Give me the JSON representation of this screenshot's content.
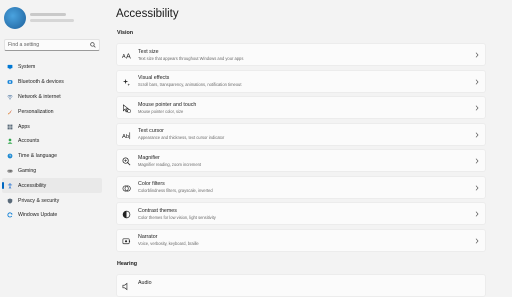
{
  "sidebar": {
    "search_placeholder": "Find a setting",
    "items": [
      {
        "label": "System",
        "icon": "system-icon",
        "color": "#0078d4"
      },
      {
        "label": "Bluetooth & devices",
        "icon": "bluetooth-icon",
        "color": "#0078d4"
      },
      {
        "label": "Network & internet",
        "icon": "network-icon",
        "color": "#5a7fa8"
      },
      {
        "label": "Personalization",
        "icon": "brush-icon",
        "color": "#d15c2b"
      },
      {
        "label": "Apps",
        "icon": "apps-icon",
        "color": "#5b6b7a"
      },
      {
        "label": "Accounts",
        "icon": "accounts-icon",
        "color": "#2ea64a"
      },
      {
        "label": "Time & language",
        "icon": "time-language-icon",
        "color": "#1f8ad2"
      },
      {
        "label": "Gaming",
        "icon": "gaming-icon",
        "color": "#6b6b6b"
      },
      {
        "label": "Accessibility",
        "icon": "accessibility-icon",
        "color": "#1f6fd1",
        "active": true
      },
      {
        "label": "Privacy & security",
        "icon": "shield-icon",
        "color": "#5b6b7a"
      },
      {
        "label": "Windows Update",
        "icon": "windows-update-icon",
        "color": "#0078d4"
      }
    ]
  },
  "main": {
    "title": "Accessibility",
    "sections": [
      {
        "title": "Vision"
      },
      {
        "title": "Hearing"
      }
    ],
    "vision_cards": [
      {
        "title": "Text size",
        "subtitle": "Text size that appears throughout Windows and your apps",
        "icon": "text-size-icon"
      },
      {
        "title": "Visual effects",
        "subtitle": "Scroll bars, transparency, animations, notification timeout",
        "icon": "visual-effects-icon"
      },
      {
        "title": "Mouse pointer and touch",
        "subtitle": "Mouse pointer color, size",
        "icon": "mouse-pointer-icon"
      },
      {
        "title": "Text cursor",
        "subtitle": "Appearance and thickness, text cursor indicator",
        "icon": "text-cursor-icon"
      },
      {
        "title": "Magnifier",
        "subtitle": "Magnifier reading, zoom increment",
        "icon": "magnifier-icon"
      },
      {
        "title": "Color filters",
        "subtitle": "Colorblindness filters, grayscale, inverted",
        "icon": "color-filters-icon"
      },
      {
        "title": "Contrast themes",
        "subtitle": "Color themes for low vision, light sensitivity",
        "icon": "contrast-themes-icon"
      },
      {
        "title": "Narrator",
        "subtitle": "Voice, verbosity, keyboard, braille",
        "icon": "narrator-icon"
      }
    ],
    "hearing_cards": [
      {
        "title": "Audio",
        "icon": "audio-icon"
      }
    ]
  }
}
